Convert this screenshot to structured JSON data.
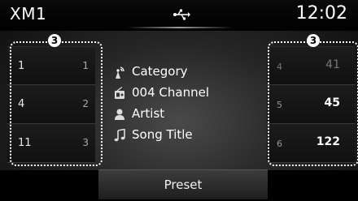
{
  "header": {
    "title": "XM1",
    "clock": "12:02",
    "status_icon": "usb-icon"
  },
  "callouts": {
    "left": "3",
    "right": "3"
  },
  "presets_left": [
    {
      "number": "1",
      "value": "1"
    },
    {
      "number": "4",
      "value": "2"
    },
    {
      "number": "11",
      "value": "3"
    }
  ],
  "presets_right": [
    {
      "number": "4",
      "value": "41",
      "dimmed": true
    },
    {
      "number": "5",
      "value": "45",
      "dimmed": false
    },
    {
      "number": "6",
      "value": "122",
      "dimmed": false
    }
  ],
  "info": {
    "category": {
      "icon": "category-icon",
      "text": "Category"
    },
    "channel": {
      "icon": "channel-icon",
      "text": "004 Channel"
    },
    "artist": {
      "icon": "artist-icon",
      "text": "Artist"
    },
    "song": {
      "icon": "music-note-icon",
      "text": "Song Title"
    }
  },
  "footer": {
    "preset_label": "Preset"
  }
}
